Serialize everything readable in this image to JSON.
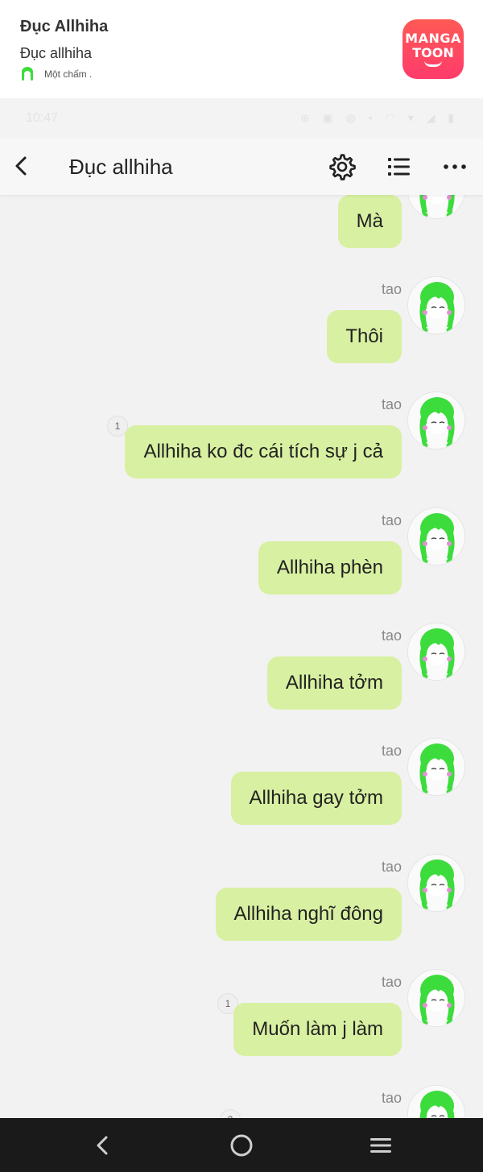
{
  "banner": {
    "title": "Đục Allhiha",
    "subtitle": "Đục allhiha",
    "meta": "Một chấm .",
    "logo_line1": "MANGA",
    "logo_line2": "TOON",
    "logo_color": "#ff4a5e"
  },
  "statusbar": {
    "time": "10:47",
    "icons_text": "⊕ ▣ ◍ •        ◠ ▾ ◢ ▮"
  },
  "header": {
    "title": "Đục allhiha",
    "back_icon": "chevron-left-icon",
    "settings_icon": "gear-icon",
    "list_icon": "list-icon",
    "more_icon": "more-dots-icon"
  },
  "messages": [
    {
      "sender": "",
      "text": "Mà",
      "badge": ""
    },
    {
      "sender": "tao",
      "text": "Thôi",
      "badge": ""
    },
    {
      "sender": "tao",
      "text": "Allhiha ko đc cái tích sự j cả",
      "badge": "1"
    },
    {
      "sender": "tao",
      "text": "Allhiha phèn",
      "badge": ""
    },
    {
      "sender": "tao",
      "text": "Allhiha tởm",
      "badge": ""
    },
    {
      "sender": "tao",
      "text": "Allhiha gay tởm",
      "badge": ""
    },
    {
      "sender": "tao",
      "text": "Allhiha nghĩ đông",
      "badge": ""
    },
    {
      "sender": "tao",
      "text": "Muốn làm j làm",
      "badge": "1"
    },
    {
      "sender": "tao",
      "text": "",
      "badge": "2"
    }
  ],
  "colors": {
    "bubble": "#d8f0a1",
    "background": "#f2f2f2",
    "avatar_hair": "#3ddc3d"
  },
  "navbar": {
    "back_icon": "nav-back-icon",
    "home_icon": "nav-home-icon",
    "menu_icon": "nav-menu-icon"
  }
}
